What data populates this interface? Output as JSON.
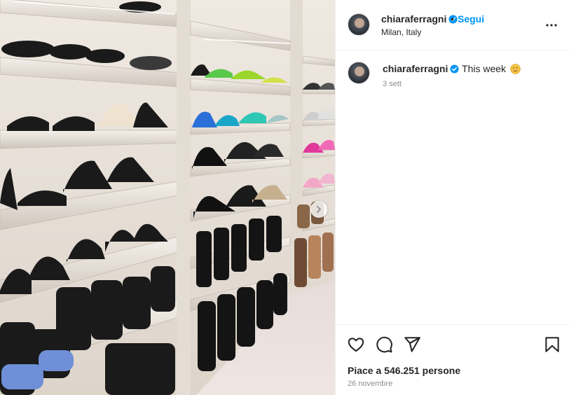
{
  "post": {
    "author": {
      "username": "chiaraferragni",
      "verified": true,
      "follow_label": "Segui",
      "location": "Milan, Italy"
    },
    "caption": {
      "username": "chiaraferragni",
      "text": "This week",
      "emoji": "smiling-face-icon",
      "time_ago": "3 sett"
    },
    "likes_text": "Piace a 546.251 persone",
    "date_text": "26 novembre",
    "icons": {
      "like": "heart-icon",
      "comment": "comment-icon",
      "share": "share-icon",
      "save": "bookmark-icon",
      "more": "more-options-icon",
      "carousel_next": "chevron-right-icon"
    }
  },
  "colors": {
    "accent": "#0095f6",
    "verified": "#0095f6",
    "muted": "#8e8e8e",
    "text": "#262626"
  }
}
